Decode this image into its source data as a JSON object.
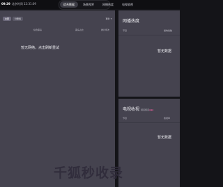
{
  "topbar": {
    "time_highlight": "09:29",
    "time_rest": "北京时间 12:31:09",
    "tabs": [
      {
        "label": "综合数据"
      },
      {
        "label": "场景视界"
      },
      {
        "label": "网播热度"
      },
      {
        "label": "电视收视"
      }
    ]
  },
  "left_panel": {
    "pills": [
      "全部",
      "分账榜"
    ],
    "refresh": "更新 ↻",
    "columns": [
      "综合票房",
      "票房占比",
      "排片场次"
    ],
    "empty_text": "暂无网络，点击刷新重试"
  },
  "web_heat": {
    "title": "网播热度",
    "columns": [
      "节目",
      "播映指数"
    ],
    "empty_text": "暂无数据"
  },
  "tv_ratings": {
    "title": "电视收视",
    "subtitle": "频道频道",
    "subtitle_accent": "▪▪▪",
    "columns": [
      "节目",
      "收视率"
    ],
    "empty_text": "暂无数据"
  },
  "watermark": "千狐秒收录"
}
